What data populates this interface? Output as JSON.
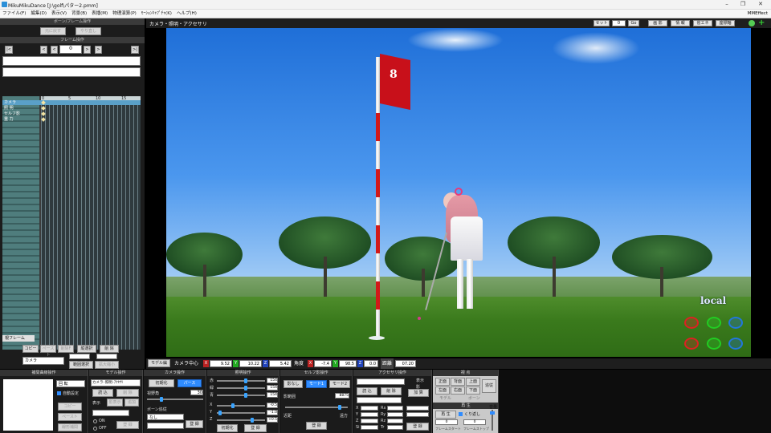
{
  "window": {
    "title": "MikuMikuDance [J:\\golf\\パター2.pmm]",
    "minimize": "–",
    "maximize": "❐",
    "close": "✕"
  },
  "menu": [
    "ファイル(F)",
    "編集(D)",
    "表示(V)",
    "背景(B)",
    "表播(M)",
    "物理演算(P)",
    "ﾓｰｼｮﾝｷｬﾌﾟﾁｬ(K)",
    "ヘルプ(H)"
  ],
  "mmeffect": "MMEffect",
  "left": {
    "bone_frame_header": "ボーン/フレーム操作",
    "undo": "元に戻す",
    "redo": "やり直し",
    "frame_op_header": "フレーム操作",
    "frame_value": "0",
    "tracks": [
      "カメラ",
      "照 明",
      "セルフ影",
      "重 力"
    ],
    "ruler": [
      "0",
      "5",
      "10",
      "15"
    ],
    "view_frame_tab": "視フレーム",
    "copy": "コピー",
    "paste": "ペースト",
    "delete_frame": "削除F",
    "vertical_select": "縦選択",
    "delete": "削 除",
    "range_select": "範囲選択",
    "expand": "拡大縮小",
    "camera_dropdown": "カメラ"
  },
  "viewport": {
    "header_title": "カメラ・照明・アクセサリ",
    "set_label": "セット",
    "set_value": "0",
    "go_label": "Go",
    "shadow_btn": "画 影",
    "info_btn": "情 報",
    "eco_btn": "省エネ",
    "coord_btn": "座標軸",
    "flag_text": "8",
    "local_label": "local"
  },
  "status": {
    "model_edit": "モデル編",
    "camera_center": "カメラ中心",
    "cx": "9.52",
    "cy": "10.22",
    "cz": "5.42",
    "angle_label": "角度",
    "ax": "-7.4",
    "ay": "98.5",
    "az": "0.0",
    "distance_label": "距離",
    "distance": "07.20"
  },
  "panels": {
    "interp": {
      "title": "補間曲線操作",
      "rotate": "回 転",
      "auto": "自動設定",
      "copy": "コピー",
      "paste": "ペースト",
      "linear": "線形補間"
    },
    "model": {
      "title": "モデル操作",
      "dropdown": "カメラ･照明･ｱｸｾｻﾘ",
      "load": "読 込",
      "delete": "削 除",
      "display": "表示",
      "shadow_toggle": "影表示",
      "add": "追加",
      "on": "ON",
      "off": "OFF",
      "register": "登 録"
    },
    "camera": {
      "title": "カメラ操作",
      "init": "初期化",
      "perspective": "パース",
      "view_angle": "視野角",
      "view_angle_value": "30",
      "bone_follow": "ボーン追従",
      "none": "なし",
      "register": "登 録"
    },
    "light": {
      "title": "照明操作",
      "rgb": [
        "赤",
        "緑",
        "青"
      ],
      "rgb_values": [
        "154",
        "154",
        "154"
      ],
      "xyz": [
        "X",
        "Y",
        "Z"
      ],
      "xyz_values": [
        "-0.5",
        "-1.0",
        "+0.5"
      ],
      "init": "初期化",
      "register": "登 録"
    },
    "selfshadow": {
      "title": "セルフ影操作",
      "none": "影なし",
      "mode1": "モード1",
      "mode2": "モード2",
      "range_label": "影範囲",
      "range_value": "8875",
      "near": "近距",
      "far": "遠方",
      "register": "登 録"
    },
    "accessory": {
      "title": "アクセサリ操作",
      "display": "表示",
      "shadow": "影",
      "load": "読 込",
      "delete": "削 除",
      "add": "加 算",
      "x": "X",
      "y": "Y",
      "z": "Z",
      "rx": "Rx",
      "ry": "Ry",
      "rz": "Rz",
      "si": "Si",
      "tr": "Tr",
      "register": "登 録"
    },
    "view": {
      "title": "視 点",
      "front": "正面",
      "back": "背面",
      "top": "上面",
      "left": "左面",
      "right": "右面",
      "bottom": "下面",
      "follow": "追従",
      "model_follow": "モデル",
      "bone": "ボーン"
    },
    "play": {
      "title": "再 生",
      "play": "再 生",
      "repeat": "くり返し",
      "start": "0",
      "end": "0",
      "frame_start": "フレームスタート",
      "frame_stop": "フレームストップ",
      "volume": "音量"
    }
  },
  "colors": {
    "accent": "#2f8cff",
    "flag": "#c8101a"
  }
}
